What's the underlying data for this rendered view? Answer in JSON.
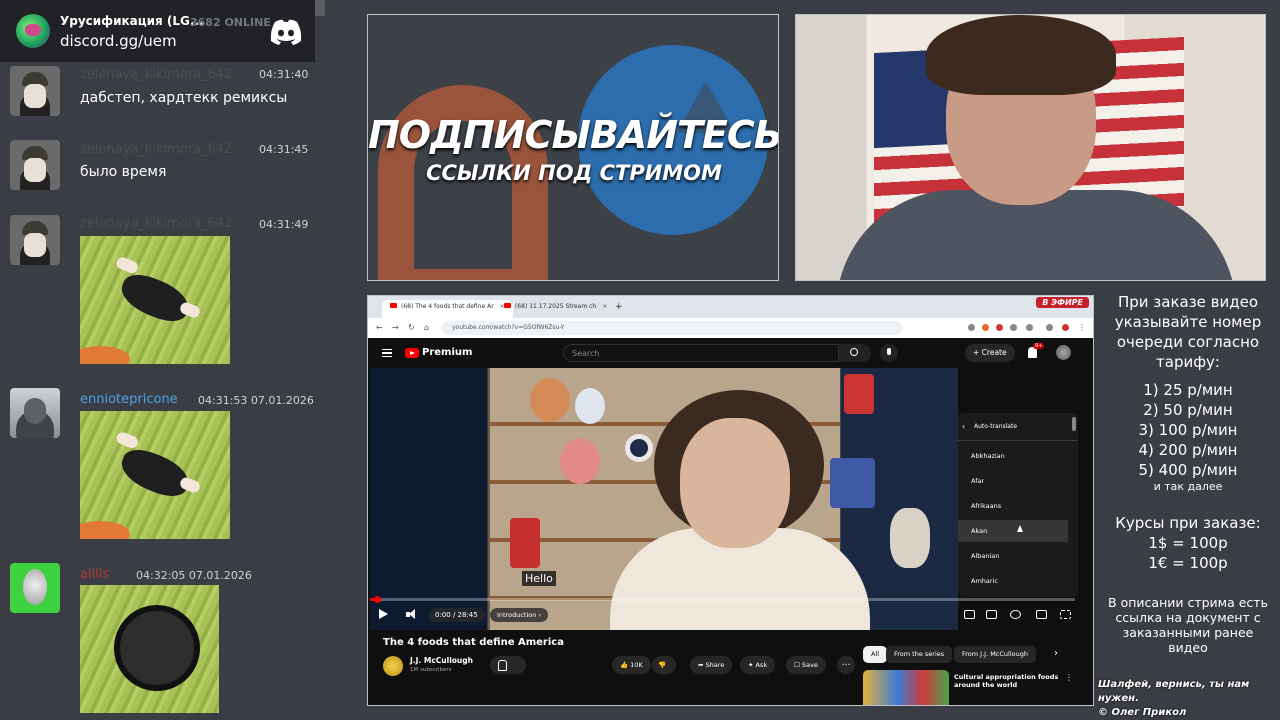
{
  "discord": {
    "server_name": "Урусификация (LG...",
    "online_count": "3682 ONLINE",
    "invite": "discord.gg/uem",
    "logo_icon": "discord-logo-icon"
  },
  "chat": {
    "messages": [
      {
        "user": "zelenaya_kikimora_642",
        "time": "04:31:40",
        "text": "дабстеп, хардтекк ремиксы"
      },
      {
        "user": "zelenaya_kikimora_642",
        "time": "04:31:45",
        "text": "было время"
      },
      {
        "user": "zelenaya_kikimora_642",
        "time": "04:31:49"
      },
      {
        "user": "enniotерricone",
        "time": "04:31:53 07.01.2026"
      },
      {
        "user": "alilis",
        "time": "04:32:05 07.01.2026"
      }
    ]
  },
  "promo": {
    "headline": "ПОДПИСЫВАЙТЕСЬ",
    "subline": "ССЫЛКИ ПОД СТРИМОМ"
  },
  "browser": {
    "tabs": [
      {
        "label": "(68) The 4 foods that define Ar",
        "close": "×"
      },
      {
        "label": "(68) 11.17.2025 Stream ch",
        "close": "×"
      }
    ],
    "newtab": "+",
    "live_badge": "В ЭФИРЕ",
    "url": "youtube.com/watch?v=G5OfW6Zsu-Y"
  },
  "youtube": {
    "brand": "Premium",
    "search_placeholder": "Search",
    "create_label": "Create",
    "notif_badge": "9+",
    "caption": "Hello",
    "time": "0:00 / 28:45",
    "chapter": "Introduction",
    "progress_fraction": 0.01,
    "menu": {
      "title": "Auto-translate",
      "languages": [
        "Abkhazian",
        "Afar",
        "Afrikaans",
        "Akan",
        "Albanian",
        "Amharic"
      ],
      "hovered": "Akan"
    },
    "video_title": "The 4 foods that define America",
    "channel": "J.J. McCullough",
    "subscribers": "1M subscribers",
    "like_count": "10K",
    "share_label": "Share",
    "ask_label": "Ask",
    "save_label": "Save",
    "chips": [
      "All",
      "From the series",
      "From J.J. McCullough"
    ],
    "rec_title": "Cultural appropriation foods around the world"
  },
  "info": {
    "order_note": "При заказе видео указывайте номер очереди согласно тарифу:",
    "tariffs": [
      "1) 25 р/мин",
      "2) 50 р/мин",
      "3) 100 р/мин",
      "4) 200 р/мин",
      "5) 400 р/мин"
    ],
    "etc": "и так далее",
    "rates_title": "Курсы при заказе:",
    "rates": [
      "1$ = 100р",
      "1€ = 100р"
    ],
    "description_note": "В описании стрима есть ссылка на документ с заказанными ранее видео",
    "footer_line1": "Шалфей, вернись, ты нам нужен.",
    "footer_line2": "© Олег Прикол"
  }
}
